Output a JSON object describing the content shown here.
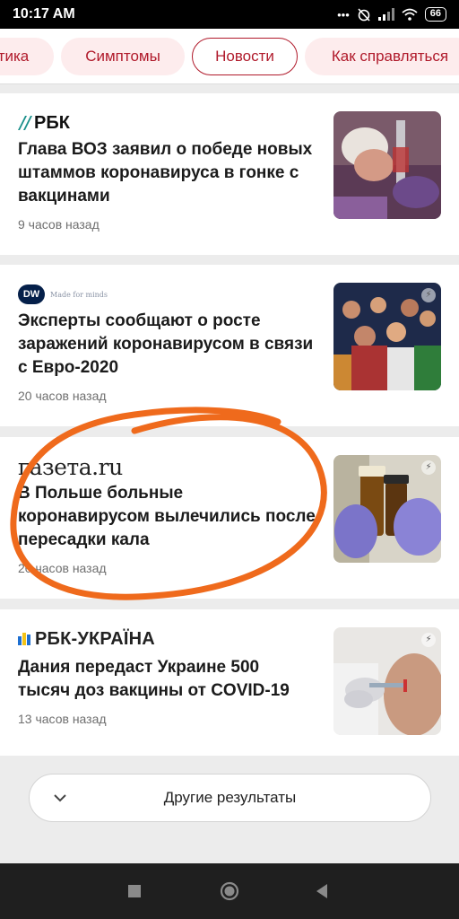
{
  "status_bar": {
    "time": "10:17 AM",
    "icons": [
      "more-dots-icon",
      "alarm-off-icon",
      "signal-icon",
      "wifi-icon",
      "battery-icon"
    ],
    "battery": "66"
  },
  "chips": [
    {
      "label": "тика",
      "active": false
    },
    {
      "label": "Симптомы",
      "active": false
    },
    {
      "label": "Новости",
      "active": true
    },
    {
      "label": "Как справляться",
      "active": false
    }
  ],
  "colors": {
    "accent": "#b01a2b",
    "chip_bg": "#fdeced",
    "annotation": "#ef6a1c"
  },
  "news": [
    {
      "source": "РБК",
      "headline": "Глава ВОЗ заявил о победе новых штаммов коронавируса в гонке с вакцинами",
      "time": "9 часов назад"
    },
    {
      "source": "DW",
      "source_tagline": "Made for minds",
      "headline": "Эксперты сообщают о росте заражений коронавирусом в связи с Евро-2020",
      "time": "20 часов назад"
    },
    {
      "source": "газета.ru",
      "headline": "В Польше больные коронавирусом вылечились после пересадки кала",
      "time": "20 часов назад"
    },
    {
      "source": "РБК-УКРАЇНА",
      "headline": "Дания передаст Украине 500 тысяч доз вакцины от COVID-19",
      "time": "13 часов назад"
    }
  ],
  "more": {
    "label": "Другие результаты"
  },
  "nav": {
    "icons": [
      "recent-apps-icon",
      "home-icon",
      "back-icon"
    ]
  }
}
